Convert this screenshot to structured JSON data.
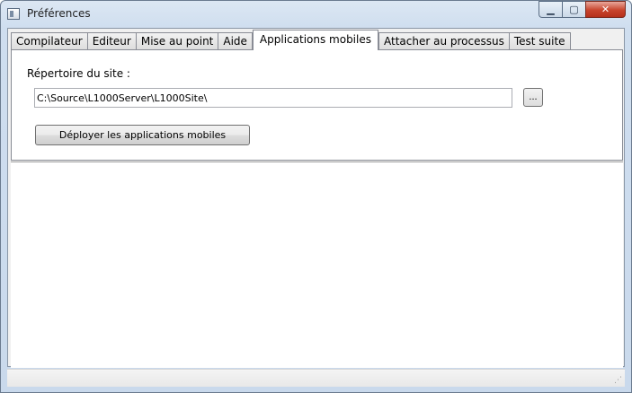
{
  "window": {
    "title": "Préférences",
    "controls": {
      "minimize": "▁",
      "maximize": "▢",
      "close": "✕"
    }
  },
  "tabs": [
    {
      "label": "Compilateur",
      "active": false
    },
    {
      "label": "Editeur",
      "active": false
    },
    {
      "label": "Mise au point",
      "active": false
    },
    {
      "label": "Aide",
      "active": false
    },
    {
      "label": "Applications mobiles",
      "active": true
    },
    {
      "label": "Attacher au processus",
      "active": false
    },
    {
      "label": "Test suite",
      "active": false
    }
  ],
  "panel": {
    "site_dir_label": "Répertoire du site :",
    "site_dir_value": "C:\\Source\\L1000Server\\L1000Site\\",
    "browse_label": "...",
    "deploy_label": "Déployer les applications mobiles"
  },
  "statusbar": {
    "grip_icon": "size-grip-icon"
  }
}
